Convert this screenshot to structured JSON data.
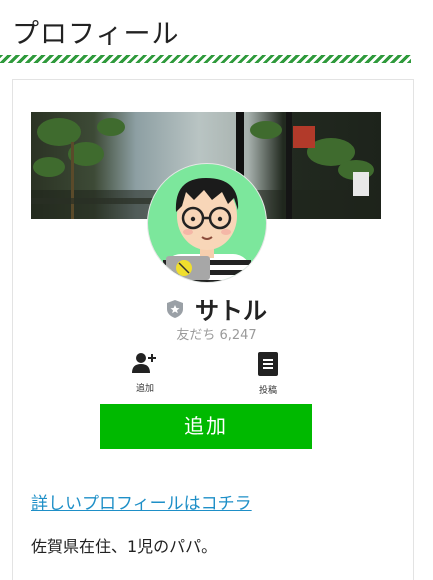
{
  "section": {
    "title": "プロフィール"
  },
  "profile": {
    "name": "サトル",
    "friends_label": "友だち 6,247",
    "actions": [
      {
        "label": "追加",
        "icon": "add-friend-icon"
      },
      {
        "label": "投稿",
        "icon": "posts-icon"
      }
    ],
    "add_button": "追加"
  },
  "link_text": "詳しいプロフィールはコチラ",
  "bio": "佐賀県在住、1児のパパ。",
  "colors": {
    "accent_green": "#00b900",
    "stripe": "#2f9a3c",
    "link": "#1e8fc7",
    "avatar_bg": "#7ce79c"
  }
}
